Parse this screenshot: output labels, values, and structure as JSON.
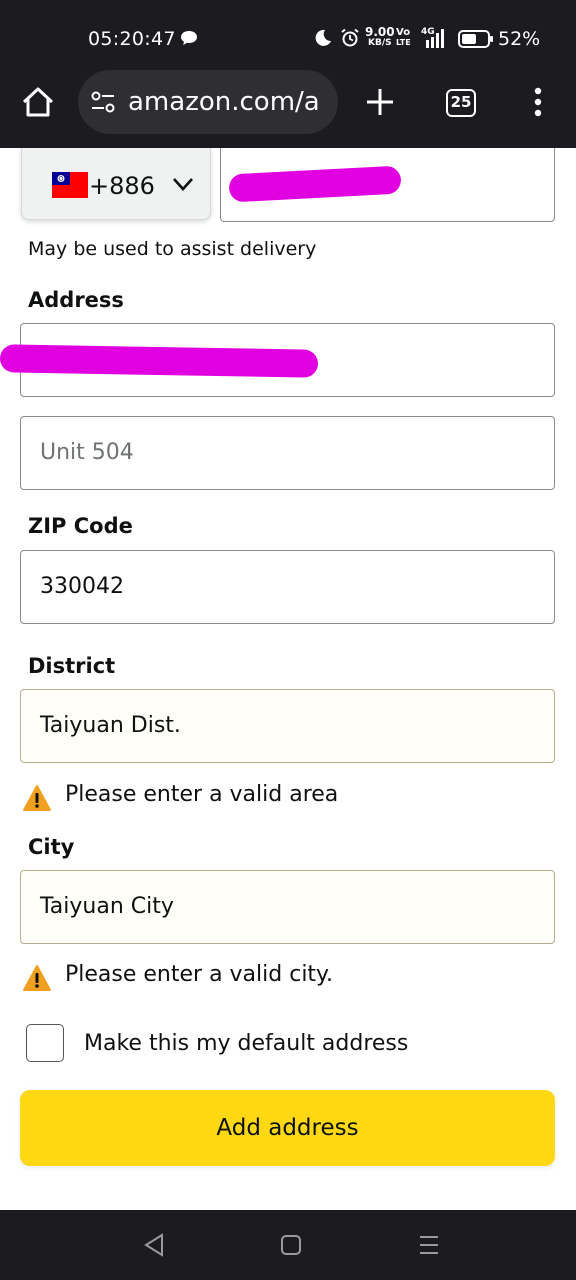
{
  "status_bar": {
    "time": "05:20:47",
    "net_speed": "9.00",
    "net_speed_unit": "KB/S",
    "volte": "Vo",
    "lte": "LTE",
    "network": "4G",
    "battery": "52%"
  },
  "browser": {
    "url": "amazon.com/a",
    "tab_count": "25"
  },
  "form": {
    "phone_country_code": "+886",
    "phone_hint": "May be used to assist delivery",
    "address_label": "Address",
    "address_line2_placeholder": "Unit 504",
    "zip_label": "ZIP Code",
    "zip_value": "330042",
    "district_label": "District",
    "district_value": "Taiyuan Dist.",
    "district_error": "Please enter a valid area",
    "city_label": "City",
    "city_value": "Taiyuan City",
    "city_error": "Please enter a valid city.",
    "default_checkbox_label": "Make this my default address",
    "submit_label": "Add address"
  },
  "colors": {
    "submit_button": "#ffd814",
    "redaction": "#e000e0",
    "warning_icon": "#f0a020",
    "system_bar": "#1c1b1f"
  }
}
